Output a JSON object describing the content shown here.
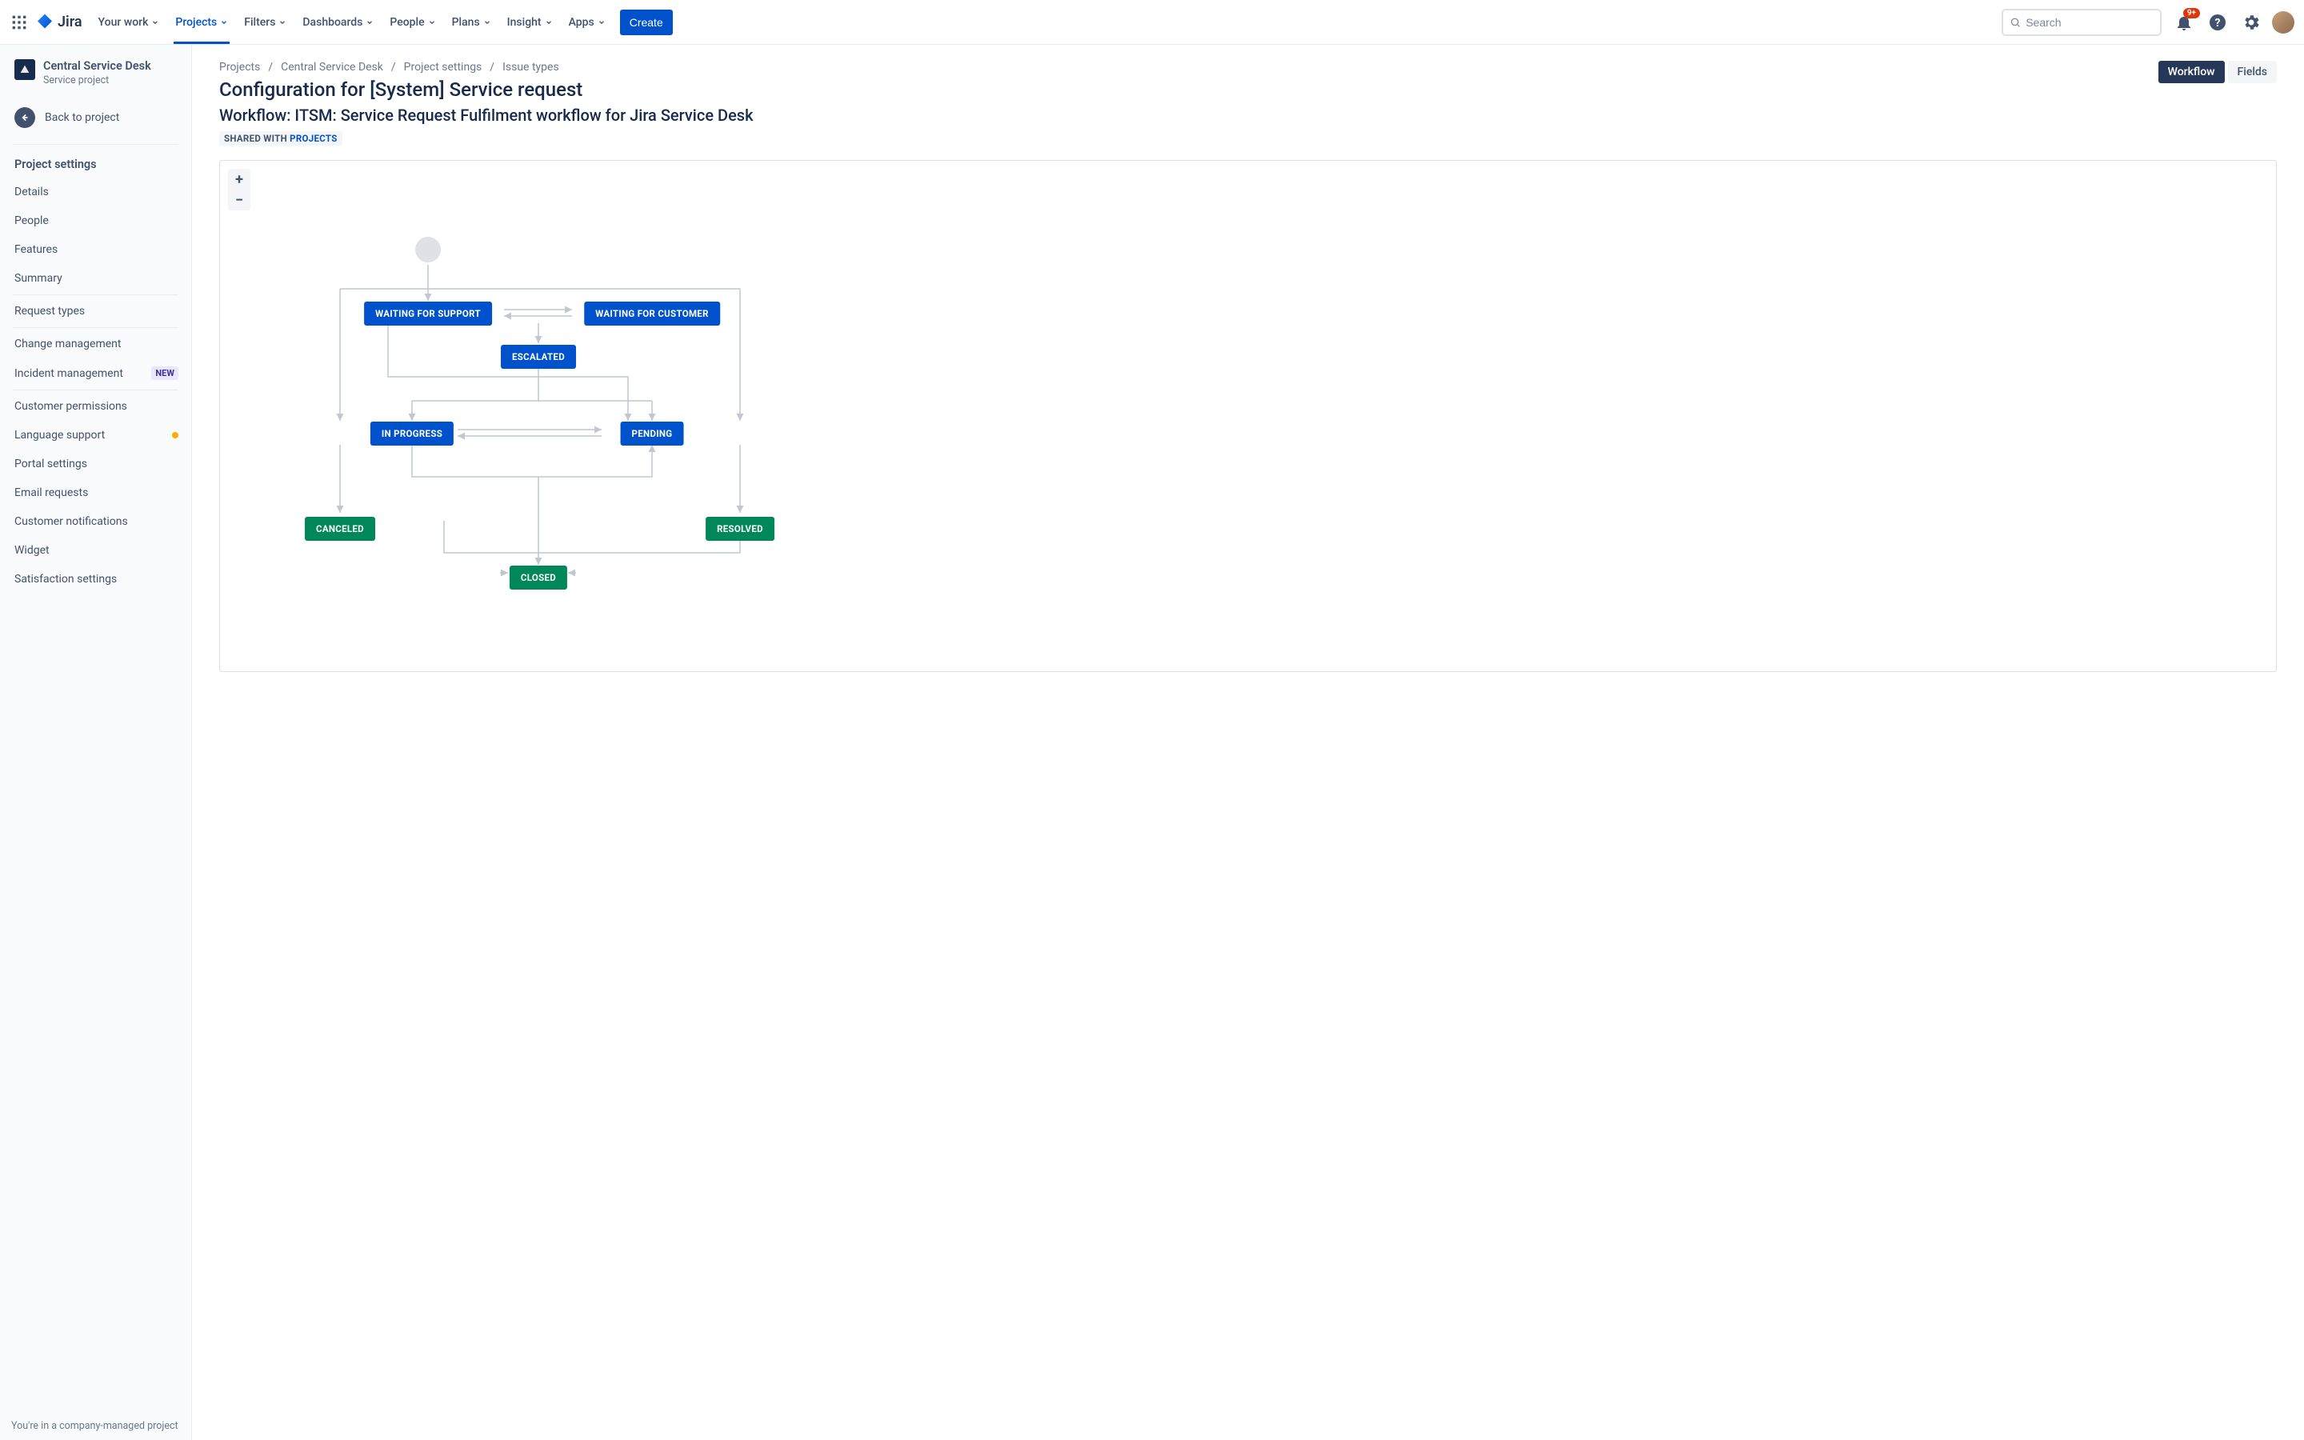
{
  "topnav": {
    "items": [
      "Your work",
      "Projects",
      "Filters",
      "Dashboards",
      "People",
      "Plans",
      "Insight",
      "Apps"
    ],
    "active_index": 1,
    "create": "Create",
    "search_placeholder": "Search",
    "notification_badge": "9+",
    "logo_text": "Jira"
  },
  "sidebar": {
    "project_title": "Central Service Desk",
    "project_subtitle": "Service project",
    "back_label": "Back to project",
    "section_title": "Project settings",
    "group1": [
      "Details",
      "People",
      "Features",
      "Summary"
    ],
    "group2_label": "Request types",
    "group3": [
      {
        "label": "Change management"
      },
      {
        "label": "Incident management",
        "badge": "NEW"
      }
    ],
    "group4": [
      {
        "label": "Customer permissions"
      },
      {
        "label": "Language support",
        "dot": true
      },
      {
        "label": "Portal settings"
      },
      {
        "label": "Email requests"
      },
      {
        "label": "Customer notifications"
      },
      {
        "label": "Widget"
      },
      {
        "label": "Satisfaction settings"
      }
    ],
    "footer": "You're in a company-managed project"
  },
  "content": {
    "breadcrumbs": [
      "Projects",
      "Central Service Desk",
      "Project settings",
      "Issue types"
    ],
    "title": "Configuration for [System] Service request",
    "subtitle": "Workflow: ITSM: Service Request Fulfilment workflow for Jira Service Desk",
    "shared_prefix": "SHARED WITH ",
    "shared_link": "PROJECTS",
    "tabs": [
      {
        "label": "Workflow",
        "active": true
      },
      {
        "label": "Fields",
        "active": false
      }
    ],
    "zoom": {
      "in": "+",
      "out": "−"
    },
    "statuses": {
      "waiting_support": "WAITING FOR SUPPORT",
      "waiting_customer": "WAITING FOR CUSTOMER",
      "escalated": "ESCALATED",
      "in_progress": "IN PROGRESS",
      "pending": "PENDING",
      "canceled": "CANCELED",
      "resolved": "RESOLVED",
      "closed": "CLOSED"
    }
  }
}
